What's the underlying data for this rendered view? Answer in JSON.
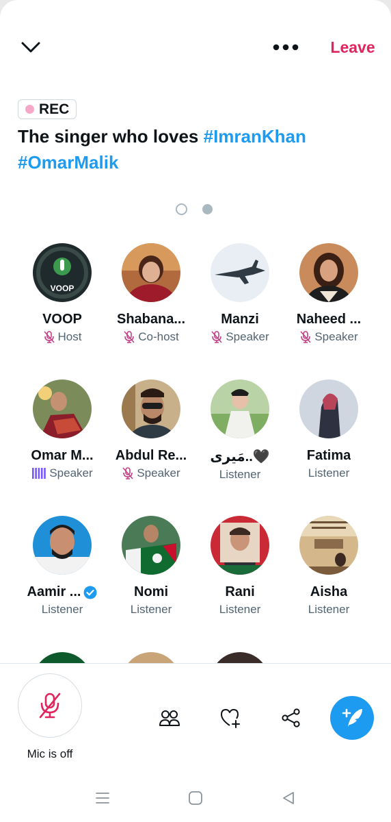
{
  "header": {
    "leave_label": "Leave",
    "rec_label": "REC"
  },
  "space": {
    "title_text": "The singer who loves ",
    "hashtag1": "#ImranKhan",
    "hashtag2": "#OmarMalik"
  },
  "participants": [
    {
      "name": "VOOP",
      "role": "Host",
      "role_icon": "mic-off-icon"
    },
    {
      "name": "Shabana...",
      "role": "Co-host",
      "role_icon": "mic-off-icon"
    },
    {
      "name": "Manzi",
      "role": "Speaker",
      "role_icon": "mic-off-icon"
    },
    {
      "name": "Naheed ...",
      "role": "Speaker",
      "role_icon": "mic-off-icon"
    },
    {
      "name": "Omar M...",
      "role": "Speaker",
      "role_icon": "speaking-bars-icon"
    },
    {
      "name": "Abdul Re...",
      "role": "Speaker",
      "role_icon": "mic-off-icon"
    },
    {
      "name": "مَیری..🖤",
      "role": "Listener"
    },
    {
      "name": "Fatima",
      "role": "Listener"
    },
    {
      "name": "Aamir ...",
      "role": "Listener",
      "verified": true
    },
    {
      "name": "Nomi",
      "role": "Listener"
    },
    {
      "name": "Rani",
      "role": "Listener"
    },
    {
      "name": "Aisha",
      "role": "Listener"
    }
  ],
  "avatar_logo_text": "VOOP",
  "bottom": {
    "mic_label": "Mic is off"
  },
  "colors": {
    "accent": "#1d9bf0",
    "leave": "#e0245e",
    "mic_off": "#c33f86",
    "speaking": "#7856ff"
  }
}
